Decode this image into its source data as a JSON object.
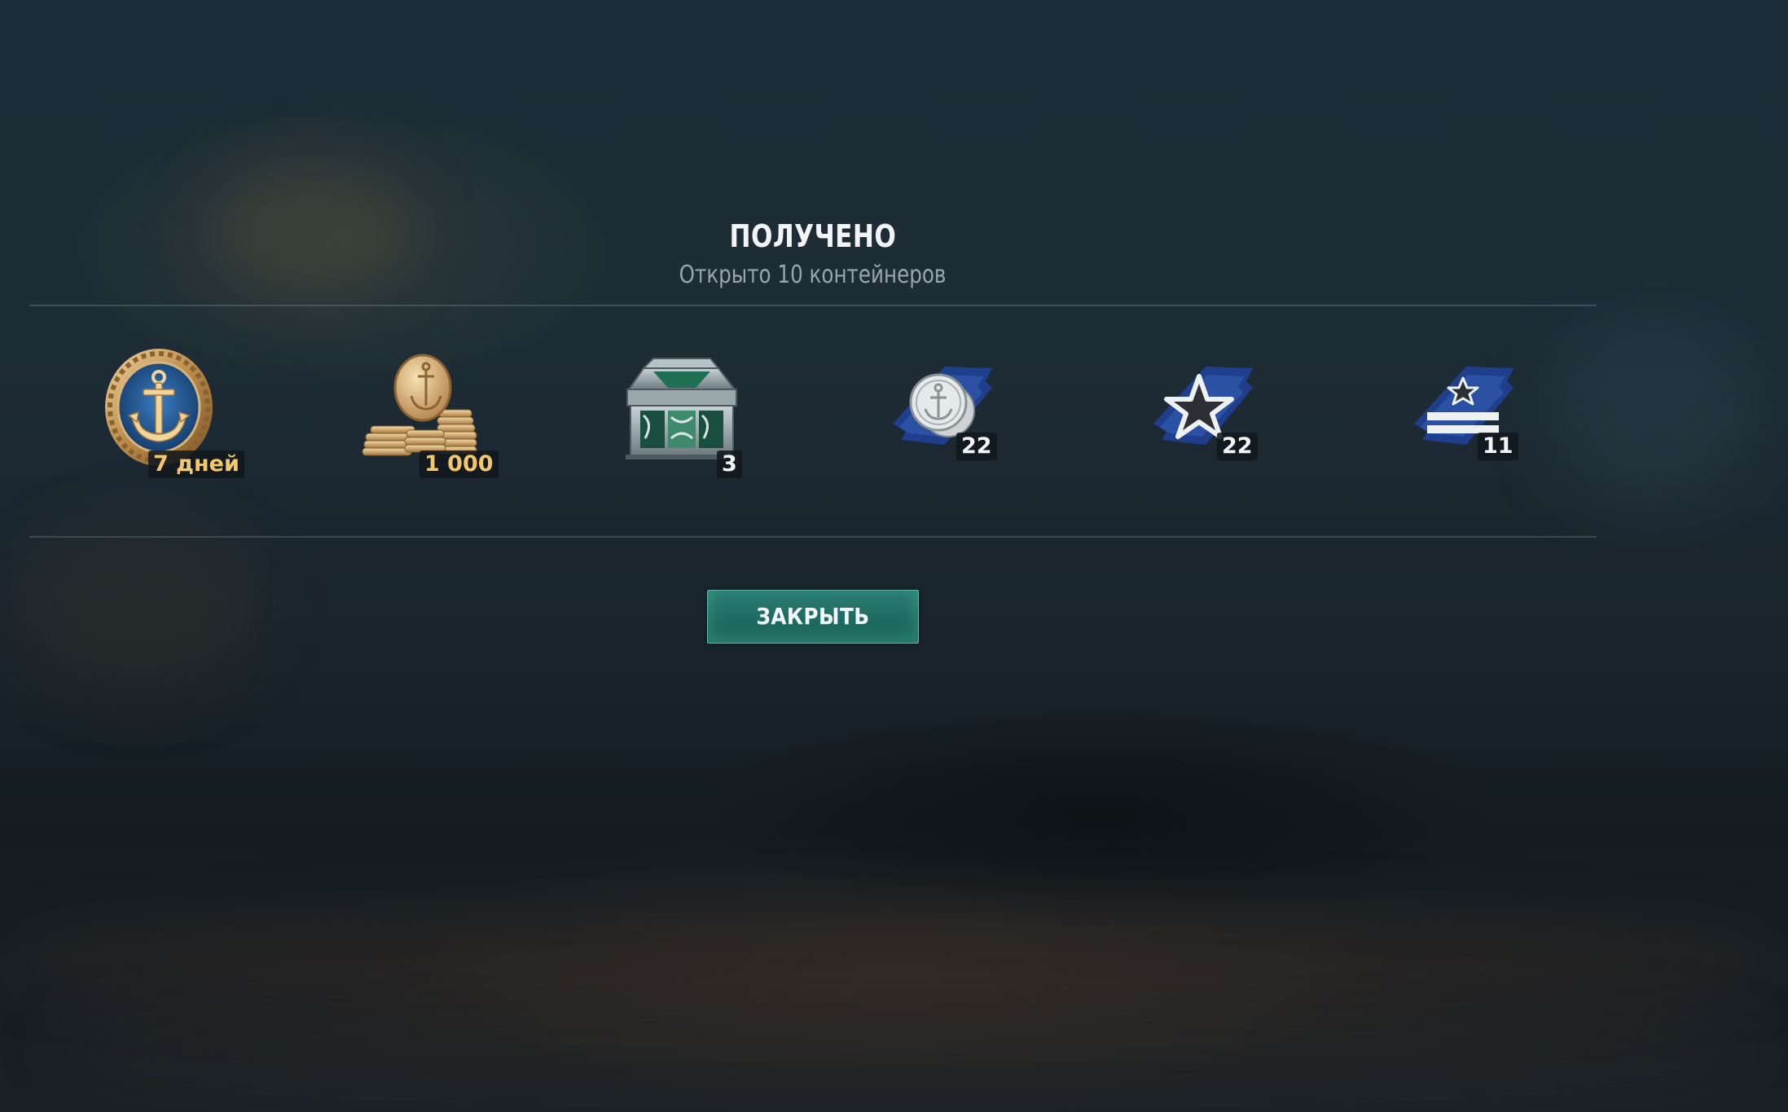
{
  "dialog": {
    "title": "ПОЛУЧЕНО",
    "subtitle": "Открыто 10 контейнеров",
    "close_label": "ЗАКРЫТЬ"
  },
  "rewards": [
    {
      "icon": "premium-account-anchor-medal-icon",
      "badge": "7 дней"
    },
    {
      "icon": "doubloons-coin-stack-icon",
      "badge": "1 000"
    },
    {
      "icon": "container-chest-icon",
      "badge": "3"
    },
    {
      "icon": "silver-anchor-coins-signal-icon",
      "badge": "22"
    },
    {
      "icon": "star-signal-flag-icon",
      "badge": "22"
    },
    {
      "icon": "commander-star-stripes-flag-icon",
      "badge": "11"
    }
  ],
  "colors": {
    "accent_teal": "#1f6b61",
    "badge_gold": "#f3c76a",
    "flag_blue": "#1f3f8c"
  }
}
